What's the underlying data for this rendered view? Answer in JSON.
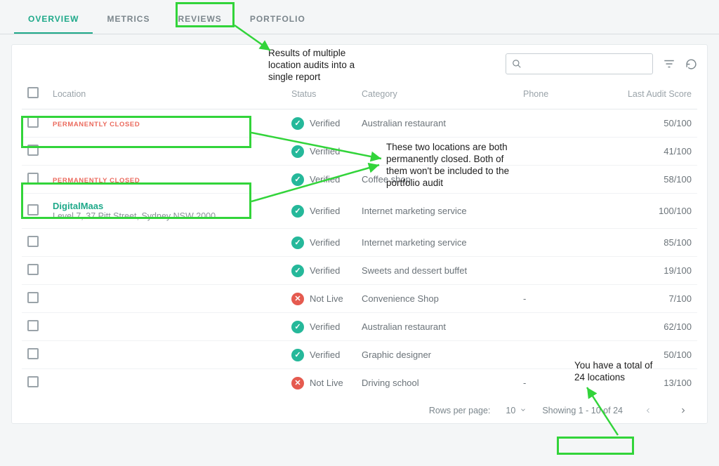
{
  "tabs": [
    "OVERVIEW",
    "METRICS",
    "REVIEWS",
    "PORTFOLIO"
  ],
  "active_tab": 0,
  "search": {
    "placeholder": ""
  },
  "columns": {
    "location": "Location",
    "status": "Status",
    "category": "Category",
    "phone": "Phone",
    "score": "Last Audit Score"
  },
  "status_labels": {
    "verified": "Verified",
    "not_live": "Not Live"
  },
  "closed_label": "PERMANENTLY CLOSED",
  "rows": [
    {
      "name": "",
      "address": "",
      "closed": true,
      "status": "verified",
      "category": "Australian restaurant",
      "phone": "",
      "score": "50/100"
    },
    {
      "name": "",
      "address": "",
      "closed": false,
      "status": "verified",
      "category": "",
      "phone": "",
      "score": "41/100"
    },
    {
      "name": "",
      "address": "",
      "closed": true,
      "status": "verified",
      "category": "Coffee shop",
      "phone": "",
      "score": "58/100"
    },
    {
      "name": "DigitalMaas",
      "address": "Level 7, 37 Pitt Street, Sydney NSW 2000",
      "closed": false,
      "status": "verified",
      "category": "Internet marketing service",
      "phone": "",
      "score": "100/100"
    },
    {
      "name": "",
      "address": "",
      "closed": false,
      "status": "verified",
      "category": "Internet marketing service",
      "phone": "",
      "score": "85/100"
    },
    {
      "name": "",
      "address": "",
      "closed": false,
      "status": "verified",
      "category": "Sweets and dessert buffet",
      "phone": "",
      "score": "19/100"
    },
    {
      "name": "",
      "address": "",
      "closed": false,
      "status": "not_live",
      "category": "Convenience Shop",
      "phone": "-",
      "score": "7/100"
    },
    {
      "name": "",
      "address": "",
      "closed": false,
      "status": "verified",
      "category": "Australian restaurant",
      "phone": "",
      "score": "62/100"
    },
    {
      "name": "",
      "address": "",
      "closed": false,
      "status": "verified",
      "category": "Graphic designer",
      "phone": "",
      "score": "50/100"
    },
    {
      "name": "",
      "address": "",
      "closed": false,
      "status": "not_live",
      "category": "Driving school",
      "phone": "-",
      "score": "13/100"
    }
  ],
  "pagination": {
    "rows_per_page_label": "Rows per page:",
    "rows_per_page": "10",
    "showing": "Showing 1 - 10 of 24"
  },
  "annotations": {
    "portfolio_note": "Results of multiple location audits into a single report",
    "closed_note": "These two locations are both permanently closed. Both of them won't be included to the portfolio audit",
    "total_note": "You have a total of 24 locations"
  },
  "colors": {
    "accent": "#1fa98a",
    "danger": "#e55a4f",
    "highlight": "#32d43a"
  }
}
